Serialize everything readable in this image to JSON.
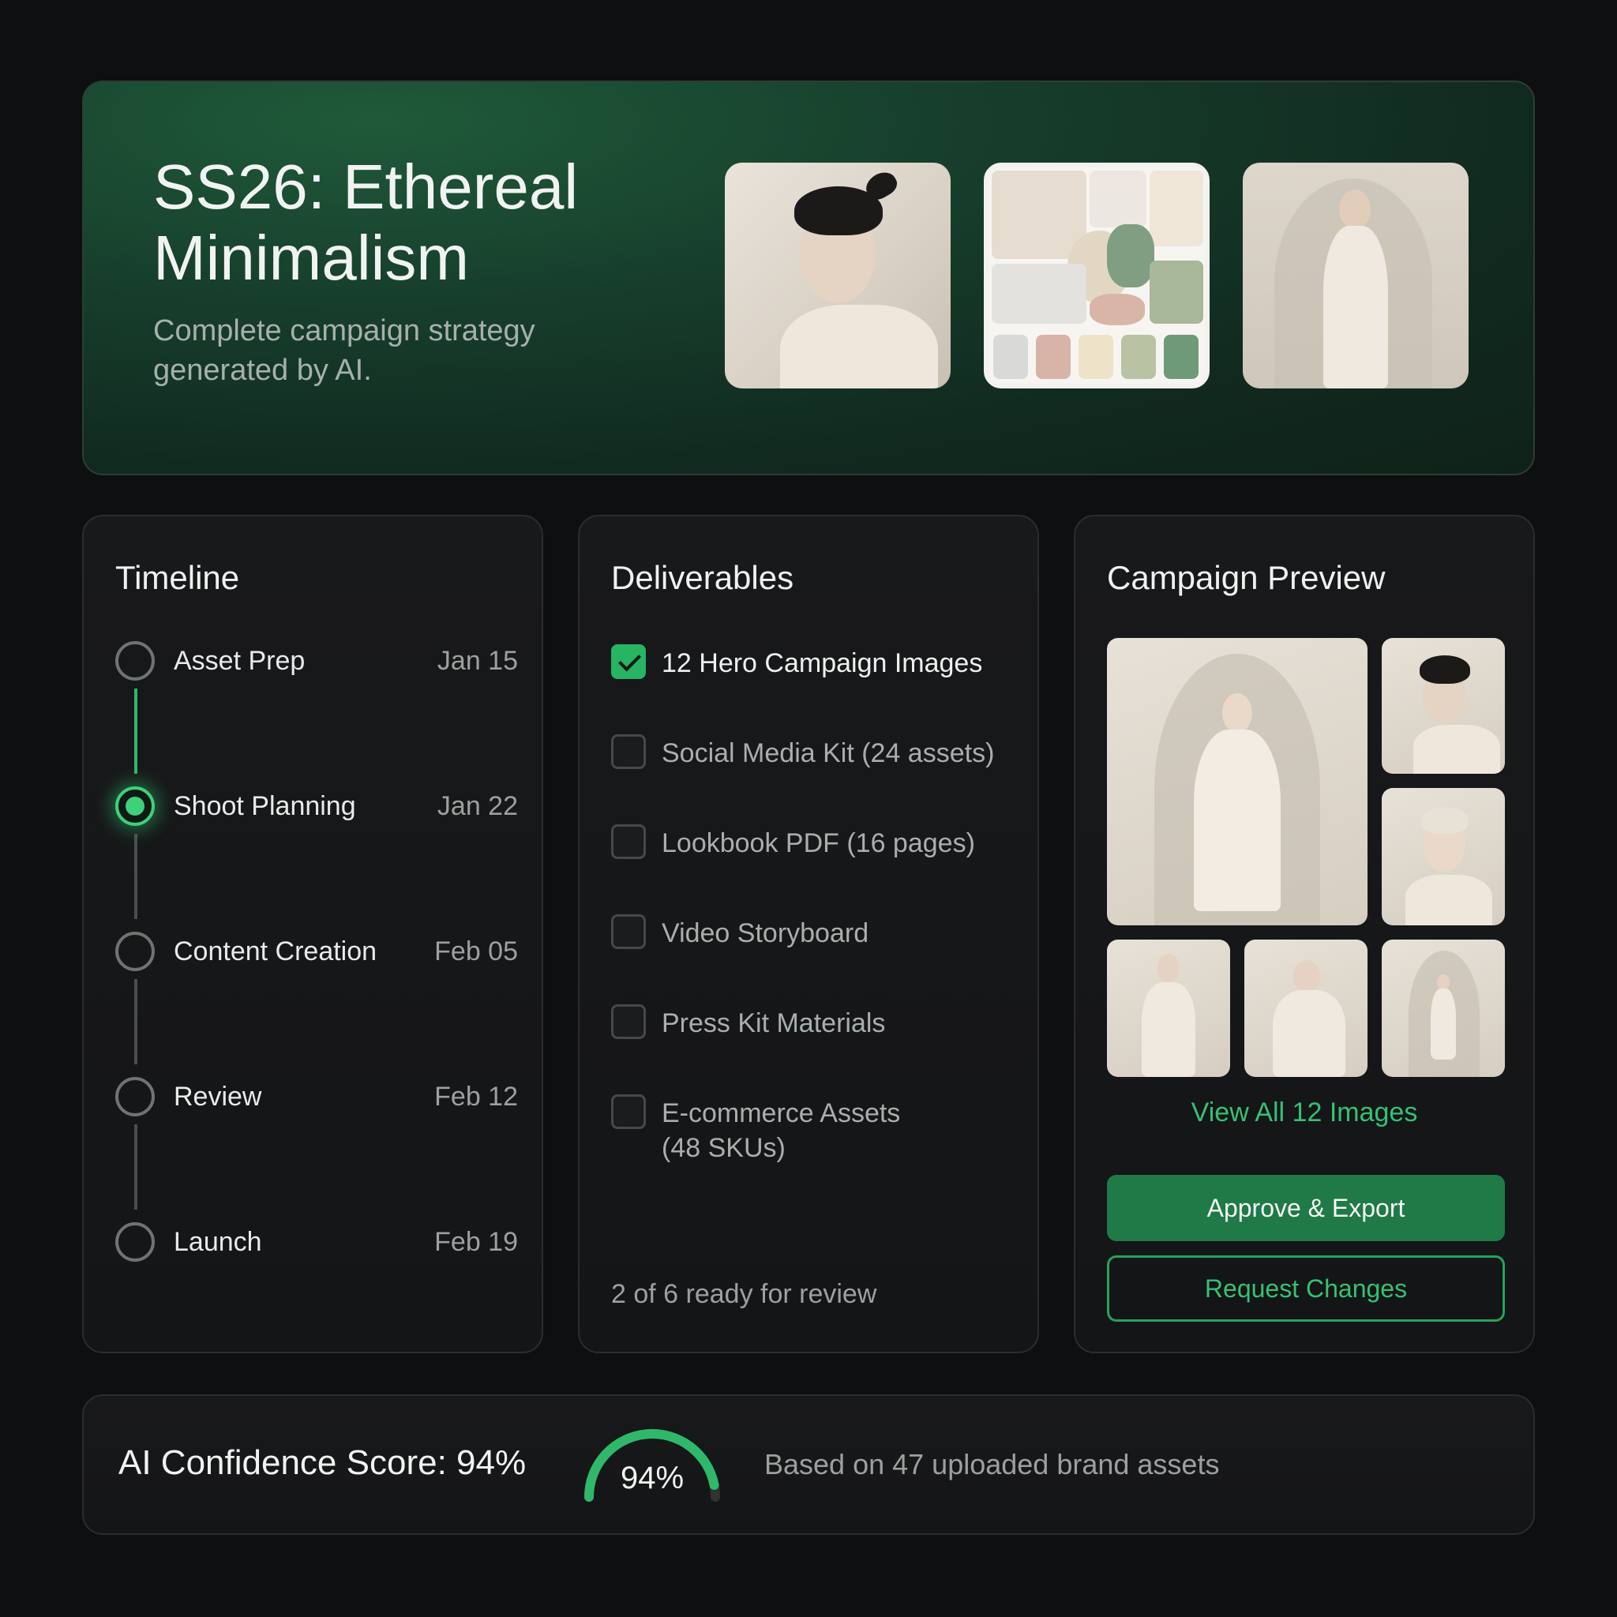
{
  "hero": {
    "title": "SS26: Ethereal Minimalism",
    "subtitle": "Complete campaign strategy generated by AI."
  },
  "timeline": {
    "title": "Timeline",
    "items": [
      {
        "label": "Asset Prep",
        "date": "Jan 15",
        "state": "pending"
      },
      {
        "label": "Shoot Planning",
        "date": "Jan 22",
        "state": "active"
      },
      {
        "label": "Content Creation",
        "date": "Feb 05",
        "state": "pending"
      },
      {
        "label": "Review",
        "date": "Feb 12",
        "state": "pending"
      },
      {
        "label": "Launch",
        "date": "Feb 19",
        "state": "pending"
      }
    ]
  },
  "deliverables": {
    "title": "Deliverables",
    "items": [
      {
        "label": "12 Hero Campaign Images",
        "checked": true
      },
      {
        "label": "Social Media Kit (24 assets)",
        "checked": false
      },
      {
        "label": "Lookbook PDF (16 pages)",
        "checked": false
      },
      {
        "label": "Video Storyboard",
        "checked": false
      },
      {
        "label": "Press Kit Materials",
        "checked": false
      },
      {
        "label": "E-commerce Assets (48 SKUs)",
        "checked": false
      }
    ],
    "footer": "2 of 6 ready for review"
  },
  "preview": {
    "title": "Campaign Preview",
    "view_all": "View All 12 Images",
    "approve_label": "Approve & Export",
    "request_label": "Request Changes"
  },
  "confidence": {
    "label": "AI Confidence Score: 94%",
    "value_text": "94%",
    "value": 0.94,
    "note": "Based on 47 uploaded brand assets"
  },
  "colors": {
    "accent": "#2fb869",
    "hero_bg": "#173f2c",
    "page_bg": "#0e0f10",
    "swatches": [
      "#d9d9d7",
      "#d8b3a8",
      "#ede3c8",
      "#b9c2a3",
      "#6f9a7a"
    ]
  }
}
